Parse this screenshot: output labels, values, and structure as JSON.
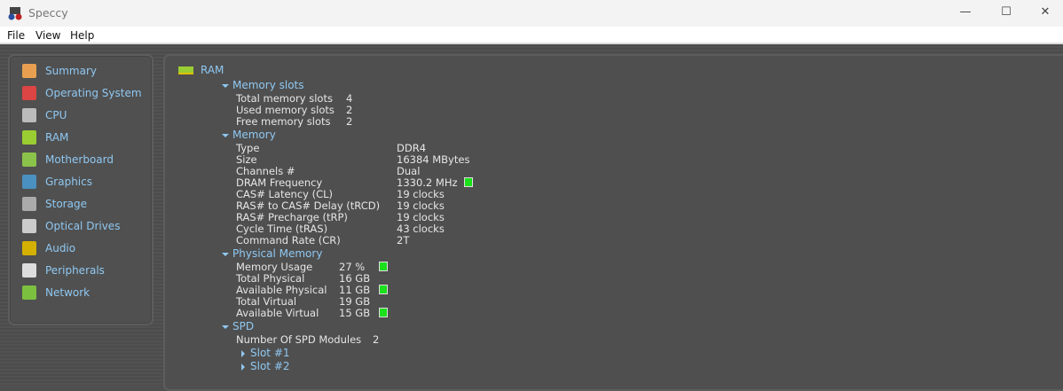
{
  "window": {
    "title": "Speccy"
  },
  "menu": [
    "File",
    "View",
    "Help"
  ],
  "sidebar": [
    {
      "label": "Summary",
      "icon": "clipboard-icon",
      "color": "#e8a050"
    },
    {
      "label": "Operating System",
      "icon": "windows-icon",
      "color": "#d44"
    },
    {
      "label": "CPU",
      "icon": "cpu-icon",
      "color": "#bbb"
    },
    {
      "label": "RAM",
      "icon": "ram-icon",
      "color": "#9acd32"
    },
    {
      "label": "Motherboard",
      "icon": "motherboard-icon",
      "color": "#8bc34a"
    },
    {
      "label": "Graphics",
      "icon": "monitor-icon",
      "color": "#4a90c0"
    },
    {
      "label": "Storage",
      "icon": "hdd-icon",
      "color": "#aaa"
    },
    {
      "label": "Optical Drives",
      "icon": "disc-icon",
      "color": "#ccc"
    },
    {
      "label": "Audio",
      "icon": "speaker-icon",
      "color": "#d4b000"
    },
    {
      "label": "Peripherals",
      "icon": "mouse-icon",
      "color": "#ddd"
    },
    {
      "label": "Network",
      "icon": "network-card-icon",
      "color": "#7cc040"
    }
  ],
  "main": {
    "title": "RAM",
    "slots": {
      "header": "Memory slots",
      "rows": [
        [
          "Total memory slots",
          "4"
        ],
        [
          "Used memory slots",
          "2"
        ],
        [
          "Free memory slots",
          "2"
        ]
      ]
    },
    "memory": {
      "header": "Memory",
      "rows": [
        [
          "Type",
          "DDR4"
        ],
        [
          "Size",
          "16384 MBytes"
        ],
        [
          "Channels #",
          "Dual"
        ],
        [
          "DRAM Frequency",
          "1330.2 MHz"
        ],
        [
          "CAS# Latency (CL)",
          "19 clocks"
        ],
        [
          "RAS# to CAS# Delay (tRCD)",
          "19 clocks"
        ],
        [
          "RAS# Precharge (tRP)",
          "19 clocks"
        ],
        [
          "Cycle Time (tRAS)",
          "43 clocks"
        ],
        [
          "Command Rate (CR)",
          "2T"
        ]
      ]
    },
    "physical": {
      "header": "Physical Memory",
      "rows": [
        [
          "Memory Usage",
          "27 %"
        ],
        [
          "Total Physical",
          "16 GB"
        ],
        [
          "Available Physical",
          "11 GB"
        ],
        [
          "Total Virtual",
          "19 GB"
        ],
        [
          "Available Virtual",
          "15 GB"
        ]
      ]
    },
    "spd": {
      "header": "SPD",
      "rows": [
        [
          "Number Of SPD Modules",
          "2"
        ]
      ],
      "slots": [
        "Slot #1",
        "Slot #2"
      ]
    }
  }
}
